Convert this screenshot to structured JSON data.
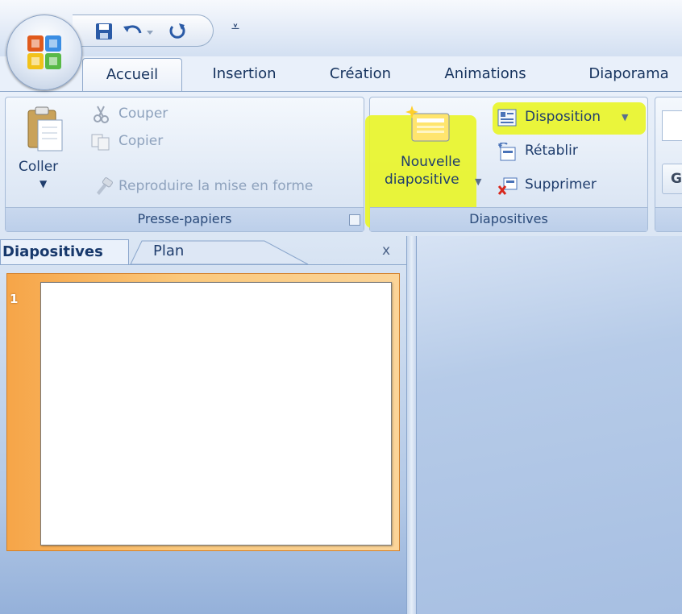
{
  "tabs": [
    {
      "label": "Accueil",
      "active": true
    },
    {
      "label": "Insertion",
      "active": false
    },
    {
      "label": "Création",
      "active": false
    },
    {
      "label": "Animations",
      "active": false
    },
    {
      "label": "Diaporama",
      "active": false
    }
  ],
  "presse_papiers": {
    "label": "Presse-papiers",
    "coller": "Coller",
    "couper": "Couper",
    "copier": "Copier",
    "reproduire": "Reproduire la mise en forme"
  },
  "diapositives_group": {
    "label": "Diapositives",
    "nouvelle_line1": "Nouvelle",
    "nouvelle_line2": "diapositive",
    "disposition": "Disposition",
    "retablir": "Rétablir",
    "supprimer": "Supprimer"
  },
  "next_group_partial": "G",
  "left_pane": {
    "tab_diapositives": "Diapositives",
    "tab_plan": "Plan",
    "close": "x",
    "slide_number": "1"
  },
  "highlight_color": "#e9f526",
  "icons": [
    "office-button-icon",
    "save-icon",
    "undo-icon",
    "redo-icon",
    "qat-dropdown-icon",
    "paste-icon",
    "scissors-icon",
    "copy-icon",
    "format-painter-icon",
    "new-slide-icon",
    "layout-icon",
    "reset-icon",
    "delete-icon"
  ]
}
